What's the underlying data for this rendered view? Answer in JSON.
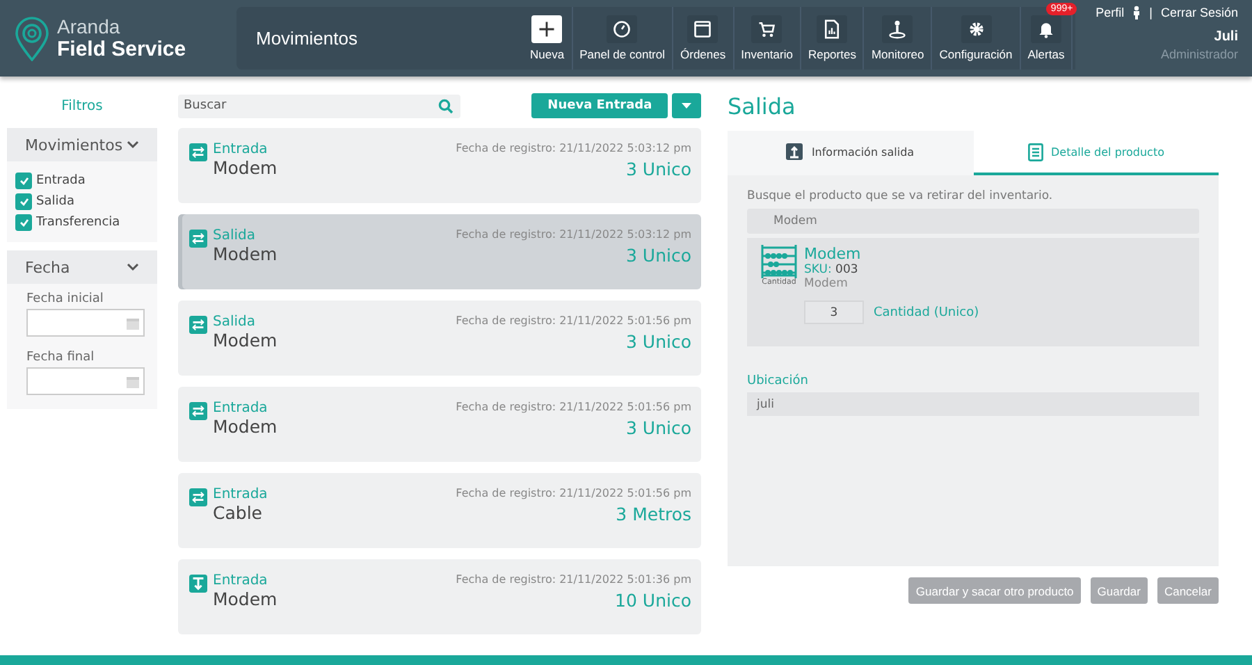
{
  "brand": {
    "line1": "Aranda",
    "line2": "Field Service"
  },
  "page_title": "Movimientos",
  "nav": [
    {
      "label": "Nueva",
      "kind": "plus",
      "selected": true
    },
    {
      "label": "Panel de control",
      "kind": "gauge",
      "selected": false
    },
    {
      "label": "Órdenes",
      "kind": "window",
      "selected": false
    },
    {
      "label": "Inventario",
      "kind": "cart",
      "selected": false
    },
    {
      "label": "Reportes",
      "kind": "report",
      "selected": false
    },
    {
      "label": "Monitoreo",
      "kind": "monitor",
      "selected": false
    },
    {
      "label": "Configuración",
      "kind": "gear",
      "selected": false
    },
    {
      "label": "Alertas",
      "kind": "bell",
      "selected": false,
      "badge": "999+"
    }
  ],
  "user": {
    "profile": "Perfil",
    "separator": "|",
    "logout": "Cerrar Sesión",
    "name": "Juli",
    "role": "Administrador"
  },
  "filters": {
    "title": "Filtros",
    "movements": {
      "title": "Movimientos",
      "expanded": true,
      "options": [
        {
          "label": "Entrada",
          "checked": true
        },
        {
          "label": "Salida",
          "checked": true
        },
        {
          "label": "Transferencia",
          "checked": true
        }
      ]
    },
    "date": {
      "title": "Fecha",
      "expanded": true,
      "fields": [
        {
          "label": "Fecha inicial"
        },
        {
          "label": "Fecha final"
        }
      ]
    }
  },
  "search": {
    "placeholder": "Buscar"
  },
  "new_button": "Nueva Entrada",
  "movements": [
    {
      "kind": "transfer",
      "type": "Entrada",
      "product": "Modem",
      "date": "Fecha de registro: 21/11/2022 5:03:12 pm",
      "quantity": "3 Unico",
      "selected": false
    },
    {
      "kind": "transfer",
      "type": "Salida",
      "product": "Modem",
      "date": "Fecha de registro: 21/11/2022 5:03:12 pm",
      "quantity": "3 Unico",
      "selected": true
    },
    {
      "kind": "transfer",
      "type": "Salida",
      "product": "Modem",
      "date": "Fecha de registro: 21/11/2022 5:01:56 pm",
      "quantity": "3 Unico",
      "selected": false
    },
    {
      "kind": "transfer",
      "type": "Entrada",
      "product": "Modem",
      "date": "Fecha de registro: 21/11/2022 5:01:56 pm",
      "quantity": "3 Unico",
      "selected": false
    },
    {
      "kind": "transfer",
      "type": "Entrada",
      "product": "Cable",
      "date": "Fecha de registro: 21/11/2022 5:01:56 pm",
      "quantity": "3 Metros",
      "selected": false
    },
    {
      "kind": "inbound",
      "type": "Entrada",
      "product": "Modem",
      "date": "Fecha de registro: 21/11/2022 5:01:36 pm",
      "quantity": "10 Unico",
      "selected": false
    }
  ],
  "detail": {
    "title": "Salida",
    "tabs": [
      {
        "label": "Información salida",
        "kind": "exit",
        "selected": false
      },
      {
        "label": "Detalle del producto",
        "kind": "list",
        "selected": true
      }
    ],
    "prompt": "Busque el producto que se va retirar del inventario.",
    "product_search": "Modem",
    "product": {
      "name": "Modem",
      "sku_label": "SKU:",
      "sku": "003",
      "description": "Modem",
      "icon_caption": "Cantidad",
      "quantity": "3",
      "quantity_label": "Cantidad (Unico)"
    },
    "location_label": "Ubicación",
    "location": "juli"
  },
  "actions": [
    "Guardar y sacar otro producto",
    "Guardar",
    "Cancelar"
  ]
}
